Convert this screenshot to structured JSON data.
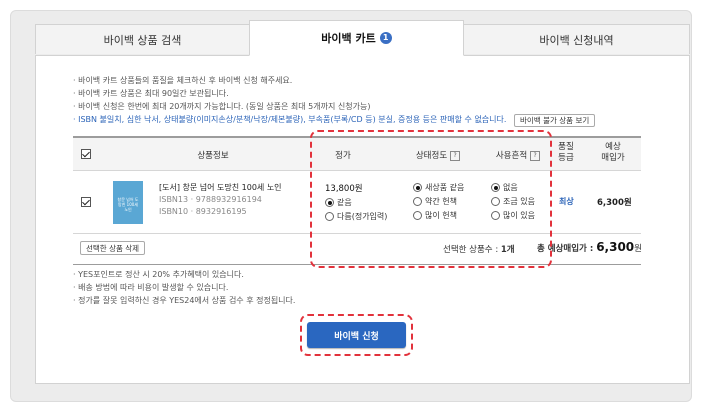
{
  "tabs": [
    {
      "label": "바이백 상품 검색"
    },
    {
      "label": "바이백 카트",
      "badge": "1"
    },
    {
      "label": "바이백 신청내역"
    }
  ],
  "notes": [
    "· 바이백 카트 상품들의 품질을 체크하신 후 바이백 신청 해주세요.",
    "· 바이백 카트 상품은 최대 90일간 보관됩니다.",
    "· 바이백 신청은 한번에 최대 20개까지 가능합니다. (동일 상품은 최대 5개까지 신청가능)",
    "· ISBN 불일치, 심한 낙서, 상태불량(이미지손상/분책/낙장/제본불량), 부속품(부록/CD 등) 분실, 증정용 등은 판매할 수 없습니다."
  ],
  "unavailable_btn": "바이백 불가 상품 보기",
  "columns": {
    "product": "상품정보",
    "price": "정가",
    "condition": "상태정도",
    "usage": "사용흔적",
    "quality_line1": "품질",
    "quality_line2": "등급",
    "expected_line1": "예상",
    "expected_line2": "매입가",
    "help": "?"
  },
  "item": {
    "cover_text": "창문 넘어 도망친 100세 노인",
    "title": "[도서] 창문 넘어 도망친 100세 노인",
    "isbn13": "ISBN13 · 9788932916194",
    "isbn10": "ISBN10 · 8932916195",
    "price": "13,800원",
    "price_options": [
      {
        "label": "같음",
        "selected": true
      },
      {
        "label": "다름(정가입력)",
        "selected": false
      }
    ],
    "condition_options": [
      {
        "label": "새상품 같음",
        "selected": true
      },
      {
        "label": "약간 헌책",
        "selected": false
      },
      {
        "label": "많이 헌책",
        "selected": false
      }
    ],
    "usage_options": [
      {
        "label": "없음",
        "selected": true
      },
      {
        "label": "조금 있음",
        "selected": false
      },
      {
        "label": "많이 있음",
        "selected": false
      }
    ],
    "grade": "최상",
    "expected_price": "6,300원"
  },
  "delete_btn": "선택한 상품 삭제",
  "summary": {
    "count_label": "선택한 상품수 : ",
    "count": "1개",
    "total_label": "총 예상매입가 : ",
    "total_number": "6,300",
    "total_unit": "원"
  },
  "footer_notes": [
    "· YES포인트로 정산 시 20% 추가혜택이 있습니다.",
    "· 배송 방법에 따라 비용이 발생할 수 있습니다.",
    "· 정가를 잘못 입력하신 경우 YES24에서 상품 검수 후 정정됩니다."
  ],
  "apply_btn": "바이백 신청",
  "colors": {
    "accent": "#2a67c0",
    "highlight": "#e2323c",
    "grade": "#2c64b8"
  }
}
